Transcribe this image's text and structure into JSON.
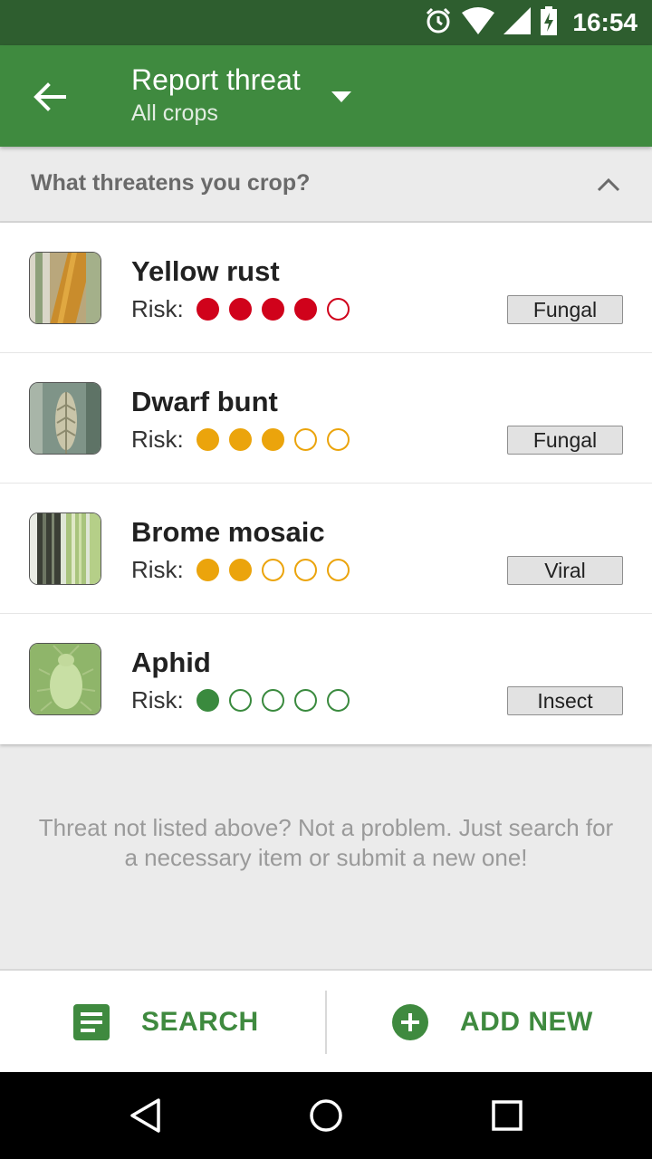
{
  "status_bar": {
    "time": "16:54"
  },
  "app_bar": {
    "title": "Report threat",
    "subtitle": "All crops"
  },
  "question": {
    "text": "What threatens you crop?"
  },
  "risk_label": "Risk:",
  "threats": [
    {
      "name": "Yellow rust",
      "risk_level": 4,
      "risk_max": 5,
      "risk_color": "#d0021b",
      "tag": "Fungal"
    },
    {
      "name": "Dwarf bunt",
      "risk_level": 3,
      "risk_max": 5,
      "risk_color": "#eba40c",
      "tag": "Fungal"
    },
    {
      "name": "Brome mosaic",
      "risk_level": 2,
      "risk_max": 5,
      "risk_color": "#eba40c",
      "tag": "Viral"
    },
    {
      "name": "Aphid",
      "risk_level": 1,
      "risk_max": 5,
      "risk_color": "#3a8a3e",
      "tag": "Insect"
    }
  ],
  "hint": {
    "text": "Threat not listed above? Not a problem. Just search for a necessary item or submit a new one!"
  },
  "actions": {
    "search_label": "SEARCH",
    "add_label": "ADD NEW"
  },
  "colors": {
    "primary": "#3f8a3f",
    "primary_dark": "#2e5e2f"
  }
}
